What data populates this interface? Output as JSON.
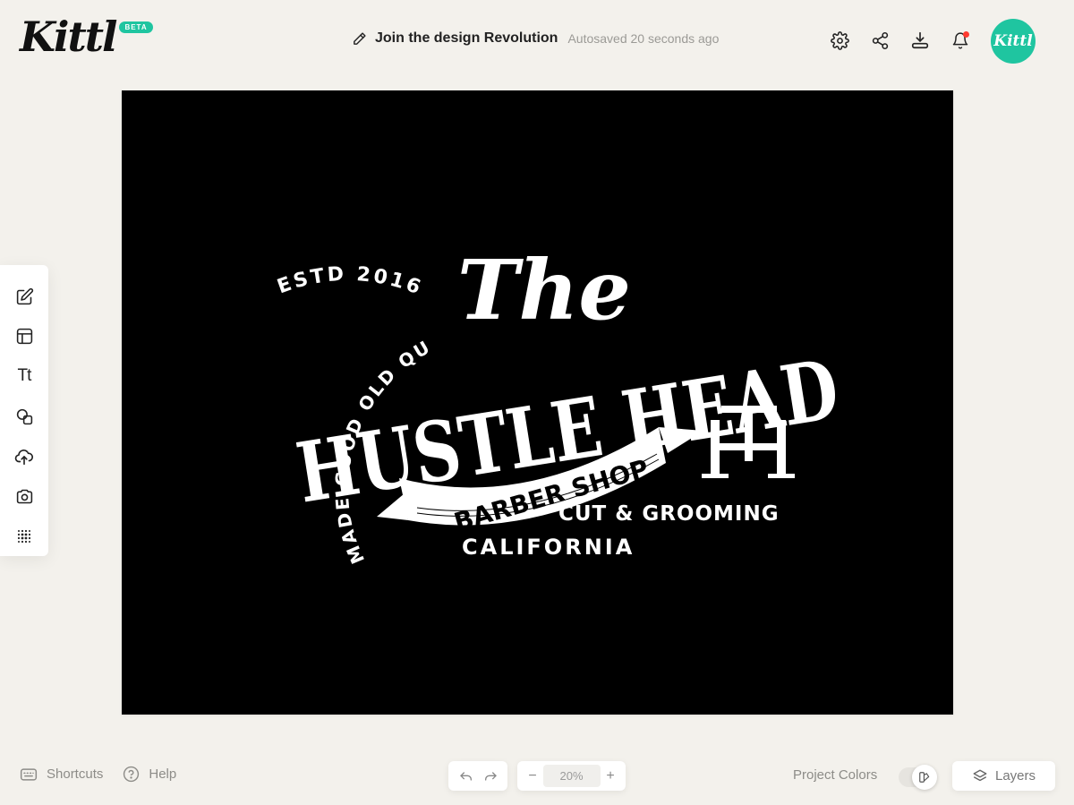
{
  "app": {
    "logo_text": "Kittl",
    "beta_label": "BETA",
    "avatar_text": "Kittl",
    "accent_color": "#1fc5a0"
  },
  "header": {
    "project_title": "Join the design Revolution",
    "autosave_status": "Autosaved 20 seconds ago",
    "actions": [
      "settings-icon",
      "share-icon",
      "download-icon",
      "bell-icon"
    ]
  },
  "left_toolbar": {
    "tools": [
      "edit-icon",
      "templates-icon",
      "text-icon",
      "shapes-icon",
      "upload-icon",
      "camera-icon",
      "halftone-icon"
    ],
    "text_tool_glyph": "Tt"
  },
  "design": {
    "background_color": "#000000",
    "estd": "ESTD 2016",
    "arc_text": "HANDMADE GOOD OLD QUALITY",
    "script_title": "The",
    "main_title": "HUSTLE HEAD",
    "banner_text": "BARBER SHOP",
    "monogram": "HT",
    "tagline": "CUT & GROOMING",
    "location": "CALIFORNIA"
  },
  "bottom_bar": {
    "shortcuts_label": "Shortcuts",
    "help_label": "Help",
    "zoom_value": "20%",
    "zoom_minus": "−",
    "zoom_plus": "+",
    "project_colors_label": "Project Colors",
    "layers_label": "Layers"
  }
}
